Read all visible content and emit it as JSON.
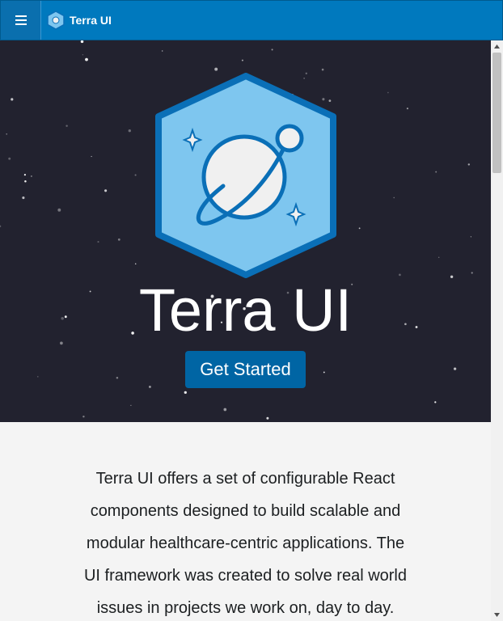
{
  "app": {
    "title": "Terra UI",
    "menu_icon": "hamburger-menu-icon",
    "logo_icon": "terra-hexagon-planet-logo-icon"
  },
  "hero": {
    "title": "Terra UI",
    "cta_label": "Get Started",
    "background_color": "#22222f"
  },
  "intro": {
    "text": "Terra UI offers a set of configurable React components designed to build scalable and modular healthcare-centric applications. The UI framework was created to solve real world issues in projects we work on, day to day."
  },
  "colors": {
    "header": "#0079be",
    "cta": "#0065a4",
    "logo_light": "#7ec6ef",
    "logo_dark": "#0a6fb7"
  }
}
